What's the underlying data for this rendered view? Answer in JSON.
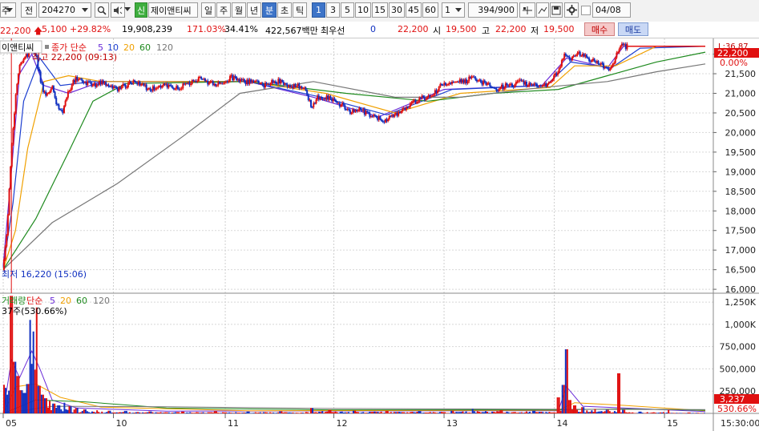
{
  "toolbar": {
    "market_label": "주",
    "field_label": "전",
    "code": "204270",
    "company_badge": "신",
    "company_name": "제이앤티씨",
    "periods": [
      "일",
      "주",
      "월",
      "년",
      "분",
      "초",
      "틱"
    ],
    "selected_period": "분",
    "intervals": [
      "1",
      "3",
      "5",
      "10",
      "15",
      "30",
      "45",
      "60"
    ],
    "selected_interval": "1",
    "multiplier": "1",
    "count": "394",
    "count_max": "/900",
    "date": "04/08"
  },
  "quote": {
    "price": "22,200",
    "change": "5,100 +29.82%",
    "volume": "19,908,239",
    "volume_ratio": "171.03%",
    "turnover": "34.41%",
    "amount": "422,567백만",
    "best_label": "최우선",
    "best_value": "0",
    "best_price": "22,200",
    "open_label": "시",
    "open": "19,500",
    "high_label": "고",
    "high": "22,200",
    "low_label": "저",
    "low": "19,500",
    "buy_label": "매수",
    "sell_label": "매도"
  },
  "price_legend": {
    "name": "이앤티씨",
    "ma_label": "종가 단순",
    "ma5": "5",
    "ma10": "10",
    "ma20": "20",
    "ma60": "60",
    "ma120": "120",
    "high_annot": "최고 22,200 (09:13)",
    "low_annot": "최저 16,220 (15:06)",
    "right_top": "L:36.87",
    "last_price_tag": "22,200",
    "pct_tag": "0.00%"
  },
  "volume_legend": {
    "label": "거래량",
    "ma_label": "단순",
    "ma5": "5",
    "ma20": "20",
    "ma60": "60",
    "ma120": "120",
    "annot": "37주(530.66%)",
    "last_vol_tag": "3,237",
    "pct_tag": "530.66%"
  },
  "colors": {
    "up": "#e01010",
    "down": "#1030c0",
    "ma5": "#6a2bd8",
    "ma10": "#1d3fd0",
    "ma20": "#f0a000",
    "ma60": "#1e8a1e",
    "ma120": "#777777"
  },
  "chart_data": {
    "type": "candlestick",
    "price_axis": [
      "22,000",
      "21,500",
      "21,000",
      "20,500",
      "20,000",
      "19,500",
      "19,000",
      "18,500",
      "18,000",
      "17,500",
      "17,000",
      "16,500",
      "16,000"
    ],
    "volume_axis": [
      "1,250K",
      "1,000K",
      "750,000",
      "500,000",
      "250,000"
    ],
    "time_axis": [
      "05",
      "10",
      "11",
      "12",
      "13",
      "14",
      "15"
    ],
    "time_axis_end": "15:30:00",
    "ylim": [
      15900,
      22400
    ],
    "volume_ylim": [
      0,
      1350000
    ],
    "close_series": [
      {
        "t": 0,
        "v": 16500
      },
      {
        "t": 2,
        "v": 16900
      },
      {
        "t": 5,
        "v": 17600
      },
      {
        "t": 8,
        "v": 18800
      },
      {
        "t": 12,
        "v": 20100
      },
      {
        "t": 16,
        "v": 21100
      },
      {
        "t": 20,
        "v": 21700
      },
      {
        "t": 25,
        "v": 21900
      },
      {
        "t": 30,
        "v": 22000
      },
      {
        "t": 35,
        "v": 22100
      },
      {
        "t": 40,
        "v": 22000
      },
      {
        "t": 45,
        "v": 21400
      },
      {
        "t": 50,
        "v": 21000
      },
      {
        "t": 55,
        "v": 21000
      },
      {
        "t": 60,
        "v": 21200
      },
      {
        "t": 66,
        "v": 20700
      },
      {
        "t": 72,
        "v": 20500
      },
      {
        "t": 78,
        "v": 20900
      },
      {
        "t": 85,
        "v": 21300
      },
      {
        "t": 92,
        "v": 21400
      },
      {
        "t": 100,
        "v": 21300
      },
      {
        "t": 110,
        "v": 21200
      },
      {
        "t": 120,
        "v": 21300
      },
      {
        "t": 130,
        "v": 21200
      },
      {
        "t": 140,
        "v": 21100
      },
      {
        "t": 150,
        "v": 21200
      },
      {
        "t": 160,
        "v": 21300
      },
      {
        "t": 170,
        "v": 21200
      },
      {
        "t": 180,
        "v": 21100
      },
      {
        "t": 190,
        "v": 21200
      },
      {
        "t": 200,
        "v": 21200
      },
      {
        "t": 210,
        "v": 21100
      },
      {
        "t": 220,
        "v": 21200
      },
      {
        "t": 230,
        "v": 21300
      },
      {
        "t": 240,
        "v": 21400
      },
      {
        "t": 250,
        "v": 21300
      },
      {
        "t": 260,
        "v": 21200
      },
      {
        "t": 270,
        "v": 21300
      },
      {
        "t": 280,
        "v": 21400
      },
      {
        "t": 290,
        "v": 21300
      },
      {
        "t": 300,
        "v": 21300
      },
      {
        "t": 310,
        "v": 21300
      },
      {
        "t": 320,
        "v": 21200
      },
      {
        "t": 330,
        "v": 21300
      },
      {
        "t": 340,
        "v": 21300
      },
      {
        "t": 350,
        "v": 21200
      },
      {
        "t": 360,
        "v": 21200
      },
      {
        "t": 370,
        "v": 21100
      },
      {
        "t": 378,
        "v": 20600
      },
      {
        "t": 385,
        "v": 20900
      },
      {
        "t": 395,
        "v": 20900
      },
      {
        "t": 405,
        "v": 20800
      },
      {
        "t": 415,
        "v": 20700
      },
      {
        "t": 425,
        "v": 20500
      },
      {
        "t": 435,
        "v": 20600
      },
      {
        "t": 445,
        "v": 20500
      },
      {
        "t": 455,
        "v": 20400
      },
      {
        "t": 465,
        "v": 20300
      },
      {
        "t": 475,
        "v": 20400
      },
      {
        "t": 485,
        "v": 20500
      },
      {
        "t": 495,
        "v": 20600
      },
      {
        "t": 505,
        "v": 20800
      },
      {
        "t": 515,
        "v": 20900
      },
      {
        "t": 525,
        "v": 20900
      },
      {
        "t": 535,
        "v": 21200
      },
      {
        "t": 545,
        "v": 21200
      },
      {
        "t": 555,
        "v": 21300
      },
      {
        "t": 565,
        "v": 21300
      },
      {
        "t": 575,
        "v": 21400
      },
      {
        "t": 585,
        "v": 21300
      },
      {
        "t": 595,
        "v": 21200
      },
      {
        "t": 605,
        "v": 21100
      },
      {
        "t": 615,
        "v": 21200
      },
      {
        "t": 625,
        "v": 21200
      },
      {
        "t": 635,
        "v": 21300
      },
      {
        "t": 645,
        "v": 21200
      },
      {
        "t": 655,
        "v": 21200
      },
      {
        "t": 665,
        "v": 21200
      },
      {
        "t": 675,
        "v": 21400
      },
      {
        "t": 682,
        "v": 21700
      },
      {
        "t": 688,
        "v": 22000
      },
      {
        "t": 695,
        "v": 21900
      },
      {
        "t": 705,
        "v": 22000
      },
      {
        "t": 715,
        "v": 21900
      },
      {
        "t": 725,
        "v": 21800
      },
      {
        "t": 735,
        "v": 21700
      },
      {
        "t": 742,
        "v": 21600
      },
      {
        "t": 750,
        "v": 21900
      },
      {
        "t": 755,
        "v": 22200
      },
      {
        "t": 860,
        "v": 22200
      }
    ],
    "ma_series": [
      {
        "name": "5",
        "color": "#6a2bd8",
        "points": [
          [
            0,
            16600
          ],
          [
            10,
            19000
          ],
          [
            20,
            21500
          ],
          [
            35,
            22000
          ],
          [
            50,
            21200
          ],
          [
            80,
            21000
          ],
          [
            120,
            21300
          ],
          [
            300,
            21300
          ],
          [
            380,
            20900
          ],
          [
            460,
            20400
          ],
          [
            540,
            21100
          ],
          [
            660,
            21200
          ],
          [
            690,
            21900
          ],
          [
            740,
            21650
          ],
          [
            760,
            22200
          ],
          [
            860,
            22200
          ]
        ]
      },
      {
        "name": "10",
        "color": "#1d3fd0",
        "points": [
          [
            0,
            16550
          ],
          [
            12,
            18200
          ],
          [
            25,
            20800
          ],
          [
            45,
            21900
          ],
          [
            70,
            21200
          ],
          [
            110,
            21300
          ],
          [
            300,
            21300
          ],
          [
            390,
            20900
          ],
          [
            470,
            20450
          ],
          [
            550,
            21100
          ],
          [
            665,
            21200
          ],
          [
            695,
            21800
          ],
          [
            745,
            21650
          ],
          [
            780,
            22150
          ],
          [
            860,
            22200
          ]
        ]
      },
      {
        "name": "20",
        "color": "#f0a000",
        "points": [
          [
            0,
            16500
          ],
          [
            15,
            17500
          ],
          [
            30,
            19600
          ],
          [
            50,
            21300
          ],
          [
            80,
            21450
          ],
          [
            120,
            21300
          ],
          [
            300,
            21300
          ],
          [
            395,
            21000
          ],
          [
            480,
            20500
          ],
          [
            560,
            21000
          ],
          [
            670,
            21150
          ],
          [
            700,
            21700
          ],
          [
            750,
            21700
          ],
          [
            800,
            22200
          ],
          [
            860,
            22200
          ]
        ]
      },
      {
        "name": "60",
        "color": "#1e8a1e",
        "points": [
          [
            0,
            16500
          ],
          [
            40,
            17800
          ],
          [
            80,
            19500
          ],
          [
            110,
            20800
          ],
          [
            150,
            21250
          ],
          [
            300,
            21300
          ],
          [
            420,
            21000
          ],
          [
            520,
            20800
          ],
          [
            600,
            21000
          ],
          [
            680,
            21100
          ],
          [
            740,
            21450
          ],
          [
            800,
            21800
          ],
          [
            860,
            22050
          ]
        ]
      },
      {
        "name": "120",
        "color": "#777777",
        "points": [
          [
            0,
            16500
          ],
          [
            60,
            17700
          ],
          [
            140,
            18700
          ],
          [
            220,
            19900
          ],
          [
            290,
            21000
          ],
          [
            380,
            21300
          ],
          [
            480,
            20900
          ],
          [
            560,
            20900
          ],
          [
            660,
            21150
          ],
          [
            740,
            21300
          ],
          [
            800,
            21550
          ],
          [
            860,
            21750
          ]
        ]
      }
    ],
    "volume_bars": [
      {
        "t": 10,
        "v": 1320000
      },
      {
        "t": 14,
        "v": 580000
      },
      {
        "t": 18,
        "v": 420000
      },
      {
        "t": 22,
        "v": 260000
      },
      {
        "t": 26,
        "v": 230000
      },
      {
        "t": 30,
        "v": 330000
      },
      {
        "t": 33,
        "v": 1050000
      },
      {
        "t": 37,
        "v": 920000
      },
      {
        "t": 41,
        "v": 1190000
      },
      {
        "t": 44,
        "v": 310000
      },
      {
        "t": 48,
        "v": 210000
      },
      {
        "t": 52,
        "v": 170000
      },
      {
        "t": 57,
        "v": 140000
      },
      {
        "t": 62,
        "v": 110000
      },
      {
        "t": 68,
        "v": 90000
      },
      {
        "t": 75,
        "v": 120000
      },
      {
        "t": 82,
        "v": 80000
      },
      {
        "t": 90,
        "v": 60000
      },
      {
        "t": 100,
        "v": 45000
      },
      {
        "t": 115,
        "v": 35000
      },
      {
        "t": 130,
        "v": 30000
      },
      {
        "t": 150,
        "v": 28000
      },
      {
        "t": 180,
        "v": 22000
      },
      {
        "t": 220,
        "v": 20000
      },
      {
        "t": 260,
        "v": 25000
      },
      {
        "t": 300,
        "v": 20000
      },
      {
        "t": 340,
        "v": 22000
      },
      {
        "t": 378,
        "v": 60000
      },
      {
        "t": 400,
        "v": 40000
      },
      {
        "t": 430,
        "v": 30000
      },
      {
        "t": 470,
        "v": 28000
      },
      {
        "t": 510,
        "v": 25000
      },
      {
        "t": 550,
        "v": 30000
      },
      {
        "t": 575,
        "v": 50000
      },
      {
        "t": 610,
        "v": 35000
      },
      {
        "t": 650,
        "v": 30000
      },
      {
        "t": 680,
        "v": 180000
      },
      {
        "t": 686,
        "v": 320000
      },
      {
        "t": 690,
        "v": 720000
      },
      {
        "t": 694,
        "v": 150000
      },
      {
        "t": 700,
        "v": 90000
      },
      {
        "t": 710,
        "v": 70000
      },
      {
        "t": 725,
        "v": 50000
      },
      {
        "t": 740,
        "v": 40000
      },
      {
        "t": 754,
        "v": 450000
      },
      {
        "t": 760,
        "v": 40000
      },
      {
        "t": 780,
        "v": 20000
      },
      {
        "t": 815,
        "v": 40000
      },
      {
        "t": 840,
        "v": 10000
      }
    ]
  }
}
